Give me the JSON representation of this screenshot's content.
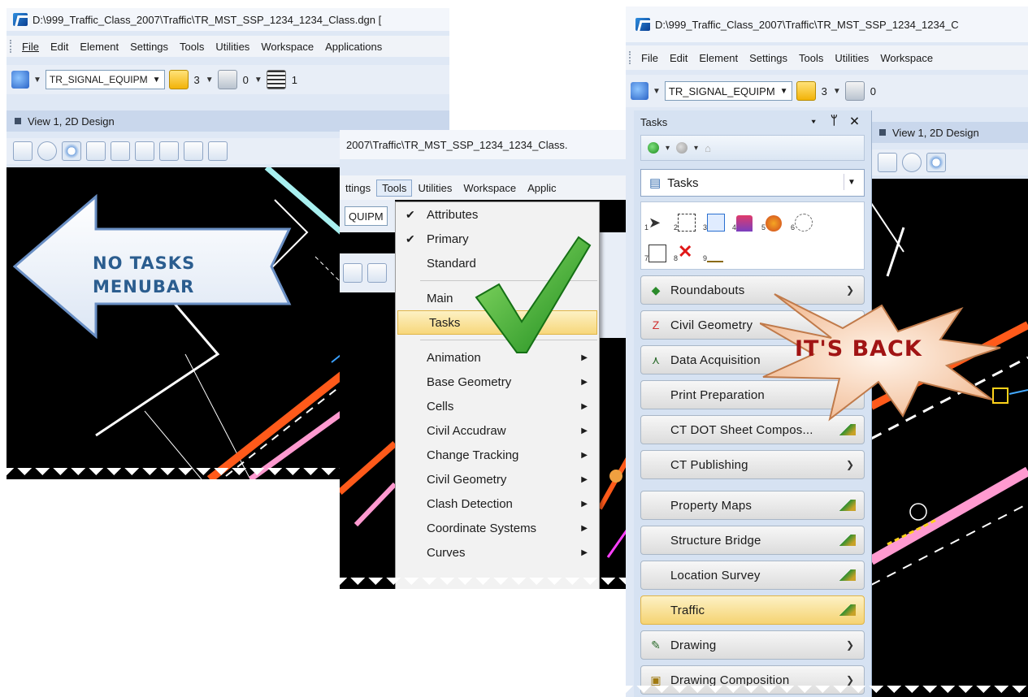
{
  "left_window": {
    "title": "D:\\999_Traffic_Class_2007\\Traffic\\TR_MST_SSP_1234_1234_Class.dgn [",
    "menu": [
      "File",
      "Edit",
      "Element",
      "Settings",
      "Tools",
      "Utilities",
      "Workspace",
      "Applications"
    ],
    "level_combo": "TR_SIGNAL_EQUIPM",
    "color_value": "3",
    "style_value": "0",
    "weight_value": "1",
    "view_title": "View 1, 2D Design"
  },
  "middle_window": {
    "title": "2007\\Traffic\\TR_MST_SSP_1234_1234_Class.",
    "menu": [
      "ttings",
      "Tools",
      "Utilities",
      "Workspace",
      "Applic"
    ],
    "canvas_combo": "QUIPM",
    "tools_menu": {
      "toolboxes": [
        {
          "label": "Attributes",
          "checked": true
        },
        {
          "label": "Primary",
          "checked": true
        },
        {
          "label": "Standard",
          "checked": false
        }
      ],
      "frames": [
        {
          "label": "Main"
        },
        {
          "label": "Tasks",
          "highlighted": true
        }
      ],
      "submenus": [
        "Animation",
        "Base Geometry",
        "Cells",
        "Civil Accudraw",
        "Change Tracking",
        "Civil Geometry",
        "Clash Detection",
        "Coordinate Systems",
        "Curves"
      ]
    }
  },
  "right_window": {
    "title": "D:\\999_Traffic_Class_2007\\Traffic\\TR_MST_SSP_1234_1234_C",
    "menu": [
      "File",
      "Edit",
      "Element",
      "Settings",
      "Tools",
      "Utilities",
      "Workspace"
    ],
    "level_combo": "TR_SIGNAL_EQUIPM",
    "color_value": "3",
    "style_value": "0",
    "view_title": "View 1, 2D Design",
    "tasks_pane": {
      "header": "Tasks",
      "combo": "Tasks",
      "tool_numbers": [
        "1",
        "2",
        "3",
        "4",
        "5",
        "6",
        "7",
        "8",
        "9"
      ],
      "items": [
        {
          "label": "Roundabouts",
          "icon": "roundabout-icon",
          "right": "chevron"
        },
        {
          "label": "Civil Geometry",
          "icon": "geometry-icon",
          "right": "none"
        },
        {
          "label": "Data Acquisition",
          "icon": "survey-icon",
          "right": "none"
        },
        {
          "label": "Print Preparation",
          "icon": "",
          "right": "none"
        },
        {
          "label": "CT DOT Sheet Compos...",
          "icon": "",
          "right": "flyout"
        },
        {
          "label": "CT Publishing",
          "icon": "",
          "right": "chevron"
        },
        {
          "label": "Property Maps",
          "icon": "",
          "right": "flyout"
        },
        {
          "label": "Structure Bridge",
          "icon": "",
          "right": "flyout"
        },
        {
          "label": "Location Survey",
          "icon": "",
          "right": "flyout"
        },
        {
          "label": "Traffic",
          "icon": "",
          "right": "flyout",
          "highlighted": true
        },
        {
          "label": "Drawing",
          "icon": "drawing-icon",
          "right": "chevron"
        },
        {
          "label": "Drawing Composition",
          "icon": "composition-icon",
          "right": "chevron"
        }
      ]
    }
  },
  "callouts": {
    "arrow_text": [
      "NO TASKS",
      "MENUBAR"
    ],
    "burst_text": "IT'S BACK"
  },
  "colors": {
    "callout_blue": "#2b5d8f",
    "burst_red": "#a11414",
    "highlight": "#f7d77b",
    "canvas": "#000000"
  }
}
